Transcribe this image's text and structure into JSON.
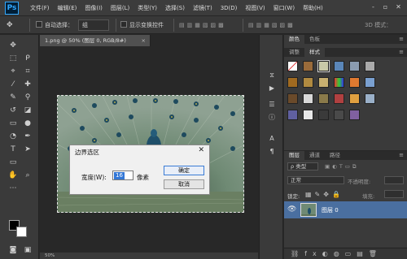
{
  "app": {
    "logo": "Ps"
  },
  "menu": [
    "文件(F)",
    "编辑(E)",
    "图像(I)",
    "图层(L)",
    "类型(Y)",
    "选择(S)",
    "滤镜(T)",
    "3D(D)",
    "视图(V)",
    "窗口(W)",
    "帮助(H)"
  ],
  "window_controls": {
    "minimize": "-",
    "restore": "▫",
    "close": "✕"
  },
  "options_bar": {
    "auto_select_label": "自动选择：",
    "auto_select_value": "组",
    "show_transform_label": "显示变换控件",
    "mode_3d_label": "3D 模式："
  },
  "document": {
    "tab_title": "1.png @ 50% (图层 0, RGB/8#)",
    "tab_close": "×",
    "status": "50%"
  },
  "dialog": {
    "title": "边界选区",
    "close": "✕",
    "width_label": "宽度(W):",
    "width_value": "16",
    "unit": "像素",
    "ok_label": "确定",
    "cancel_label": "取消"
  },
  "panels": {
    "top_tabs": [
      "颜色",
      "色板"
    ],
    "mid_tabs": [
      "调整",
      "样式"
    ],
    "layers_tabs": [
      "图层",
      "通道",
      "路径"
    ],
    "kind_label": "ρ 类型",
    "blend_mode": "正常",
    "opacity_label": "不透明度:",
    "lock_label": "锁定:",
    "fill_label": "填充:",
    "layer_name": "图层 0"
  },
  "colors": {
    "fg": "#000000",
    "bg": "#ffffff",
    "accent": "#3a7bd5",
    "layer_selected": "#4a6fa0"
  },
  "icons": {
    "tools": [
      "move-icon",
      "marquee-icon",
      "lasso-icon",
      "quick-select-icon",
      "crop-icon",
      "eyedropper-icon",
      "healing-icon",
      "brush-icon",
      "stamp-icon",
      "history-brush-icon",
      "eraser-icon",
      "gradient-icon",
      "blur-icon",
      "dodge-icon",
      "pen-icon",
      "type-icon",
      "path-select-icon",
      "shape-icon",
      "hand-icon",
      "zoom-icon"
    ],
    "strip": [
      "history-icon",
      "actions-icon",
      "properties-icon",
      "info-icon",
      "character-icon",
      "paragraph-icon"
    ]
  }
}
